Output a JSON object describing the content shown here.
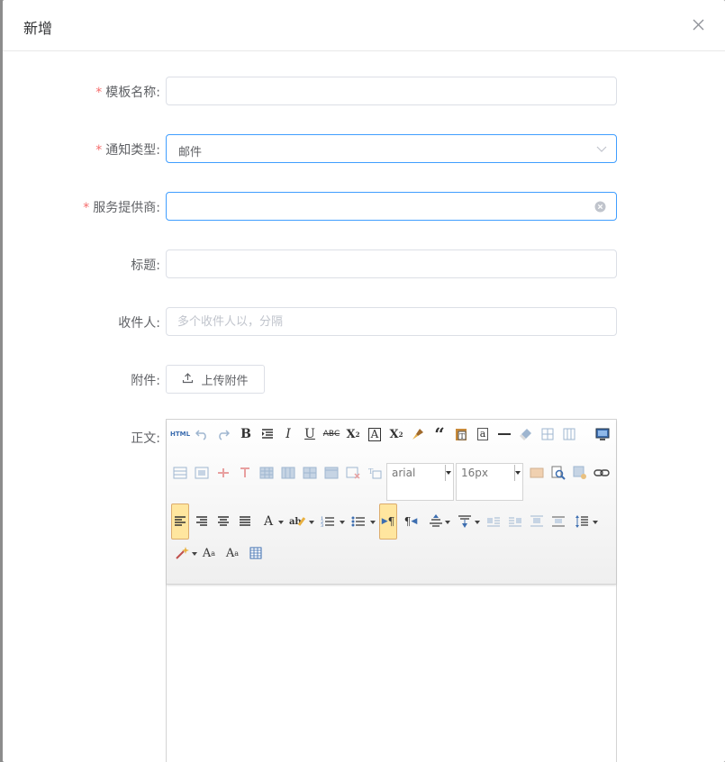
{
  "dialog": {
    "title": "新增"
  },
  "form": {
    "template_name": {
      "label": "模板名称",
      "value": ""
    },
    "notify_type": {
      "label": "通知类型",
      "value": "邮件"
    },
    "provider": {
      "label": "服务提供商",
      "value": ""
    },
    "subject": {
      "label": "标题",
      "value": ""
    },
    "recipients": {
      "label": "收件人",
      "placeholder": "多个收件人以，分隔"
    },
    "attachment": {
      "label": "附件",
      "button_label": "上传附件"
    },
    "body": {
      "label": "正文"
    }
  },
  "editor": {
    "font_family": "arial",
    "font_size": "16px",
    "toolbar_icons": [
      "html-source-icon",
      "undo-icon",
      "redo-icon",
      "bold-icon",
      "indent-icon",
      "italic-icon",
      "underline-icon",
      "strikethrough-icon",
      "subscript-icon",
      "font-border-icon",
      "superscript-icon",
      "format-brush-icon",
      "blockquote-icon",
      "paste-plain-icon",
      "select-all-icon",
      "horizontal-rule-icon",
      "clear-format-icon",
      "insert-row-icon",
      "insert-col-icon",
      "preview-icon",
      "table-icon",
      "merge-cells-icon",
      "split-icon",
      "delete-icon",
      "insert-row-icon-2",
      "insert-col-icon-2",
      "merge-right-icon",
      "merge-down-icon",
      "delete-table-icon",
      "table-title-icon",
      "image-icon",
      "search-replace-icon",
      "insert-image-icon",
      "link-icon",
      "align-left-icon",
      "align-right-icon",
      "align-center-icon",
      "align-justify-icon",
      "font-color-icon",
      "highlight-icon",
      "ordered-list-icon",
      "unordered-list-icon",
      "ltr-icon",
      "rtl-icon",
      "row-spacing-top-icon",
      "row-spacing-bottom-icon",
      "image-left-icon",
      "image-right-icon",
      "image-none-icon",
      "image-center-icon",
      "line-height-icon",
      "magic-wand-icon",
      "font-increase-icon",
      "font-decrease-icon",
      "grid-icon"
    ]
  },
  "colors": {
    "required": "#f56c6c",
    "focus_border": "#409eff",
    "active_button": "#ffe69f"
  }
}
